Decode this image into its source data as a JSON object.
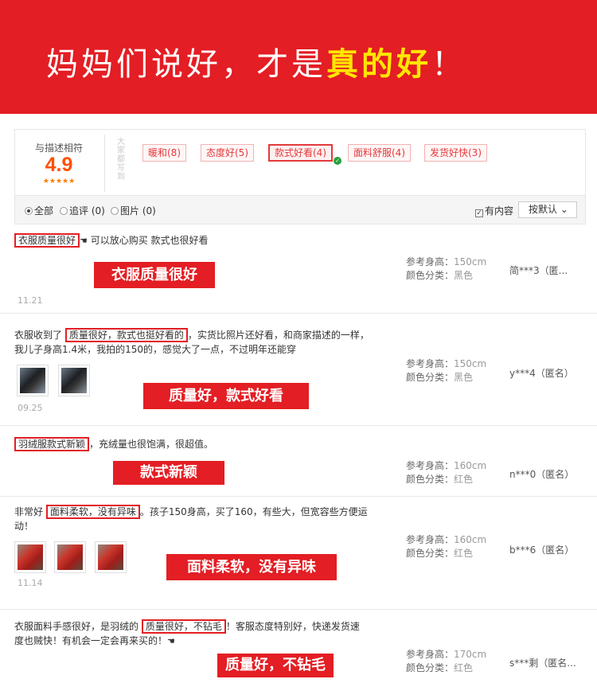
{
  "banner": {
    "text_main": "妈妈们说好，才是",
    "text_highlight": "真的好",
    "text_end": "！"
  },
  "rating": {
    "label": "与描述相符",
    "score": "4.9",
    "stars": "★★★★★",
    "side_label": "大家都写到"
  },
  "tags": [
    {
      "label": "暖和(8)"
    },
    {
      "label": "态度好(5)"
    },
    {
      "label": "款式好看(4)"
    },
    {
      "label": "面料舒服(4)"
    },
    {
      "label": "发货好快(3)"
    }
  ],
  "filters": {
    "all": "全部",
    "followup": "追评 (0)",
    "pictures": "图片 (0)",
    "has_content": "有内容",
    "sort": "按默认",
    "sort_arrow": "⌄"
  },
  "meta_labels": {
    "height": "参考身高：",
    "color": "颜色分类："
  },
  "reviews": [
    {
      "pre": "",
      "highlight": "衣服质量很好",
      "post": " 可以放心购买 款式也很好看",
      "height": "150cm",
      "color": "黑色",
      "user": "简***3（匿...",
      "date": "11.21",
      "callout": "衣服质量很好",
      "hand": "☚"
    },
    {
      "pre": "衣服收到了 ",
      "highlight": "质量很好，款式也挺好看的",
      "post": "，实货比照片还好看，和商家描述的一样，",
      "line2": "我儿子身高1.4米，我拍的150的，感觉大了一点，不过明年还能穿",
      "height": "150cm",
      "color": "黑色",
      "user": "y***4（匿名）",
      "date": "09.25",
      "callout": "质量好，款式好看"
    },
    {
      "pre": "",
      "highlight": "羽绒服款式新颖",
      "post": "，充绒量也很饱满，很超值。",
      "height": "160cm",
      "color": "红色",
      "user": "n***0（匿名）",
      "callout": "款式新颖"
    },
    {
      "pre": "非常好 ",
      "highlight": "面料柔软，没有异味",
      "post": "。孩子150身高，买了160，有些大，但宽容些方便运",
      "line2": "动！",
      "height": "160cm",
      "color": "红色",
      "user": "b***6（匿名）",
      "date": "11.14",
      "callout": "面料柔软，没有异味"
    },
    {
      "pre": "衣服面料手感很好，是羽绒的 ",
      "highlight": "质量很好，不钻毛",
      "post": "！客服态度特别好，快递发货速",
      "line2": "度也贼快！有机会一定会再来买的！",
      "height": "170cm",
      "color": "红色",
      "user": "s***剩（匿名...",
      "callout": "质量好，不钻毛",
      "hand": "☚"
    }
  ]
}
